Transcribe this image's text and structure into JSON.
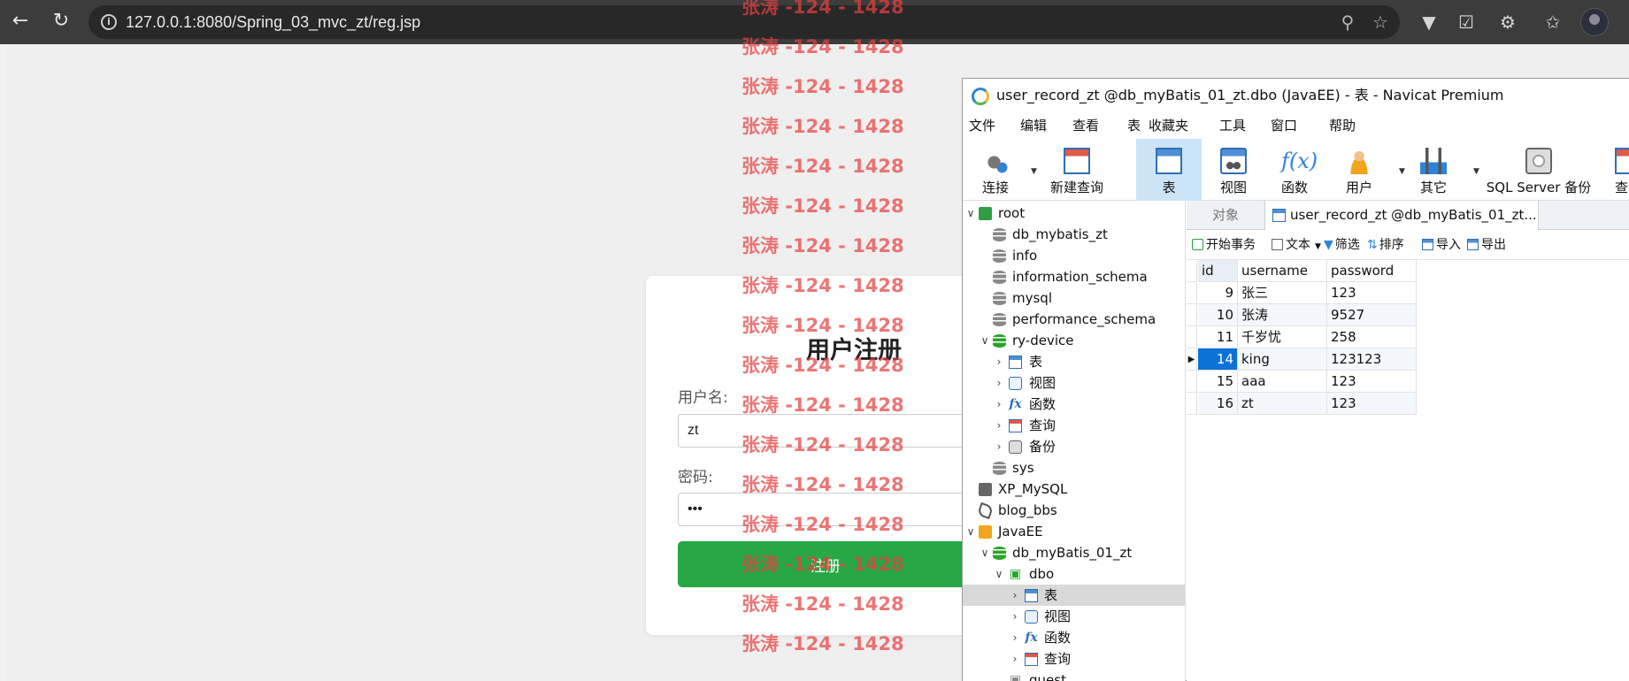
{
  "browser": {
    "url": "127.0.0.1:8080/Spring_03_mvc_zt/reg.jsp",
    "back_icon": "arrow-left",
    "reload_icon": "reload",
    "info_icon": "info-circle",
    "zoom_icon": "magnifier",
    "star_icon": "star"
  },
  "form": {
    "title": "用户注册",
    "username_label": "用户名:",
    "username_value": "zt",
    "password_label": "密码:",
    "password_value": "•••",
    "submit_label": "注册",
    "accent_color": "#28a745"
  },
  "watermark": {
    "text": "张涛 -124 - 1428",
    "lines": [
      "张涛 -124 - 1428",
      "张涛 -124 - 1428",
      "张涛 -124 - 1428",
      "张涛 -124 - 1428",
      "张涛 -124 - 1428",
      "张涛 -124 - 1428",
      "张涛 -124 - 1428",
      "张涛 -124 - 1428",
      "张涛 -124 - 1428",
      "张涛 -124 - 1428",
      "张涛 -124 - 1428",
      "张涛 -124 - 1428",
      "张涛 -124 - 1428",
      "张涛 -124 - 1428",
      "张涛 -124 - 1428",
      "张涛 -124 - 1428",
      "张涛 -124 - 1428"
    ]
  },
  "navicat": {
    "title": "user_record_zt @db_myBatis_01_zt.dbo (JavaEE) - 表 - Navicat Premium",
    "menu": [
      "文件",
      "编辑",
      "查看",
      "表",
      "收藏夹",
      "工具",
      "窗口",
      "帮助"
    ],
    "toolbar": {
      "connect": "连接",
      "new_query": "新建查询",
      "table": "表",
      "view": "视图",
      "function": "函数",
      "user": "用户",
      "other": "其它",
      "sqlserver_backup": "SQL Server 备份",
      "query": "查询"
    },
    "tree": {
      "root": "root",
      "db_mybatis_zt": "db_mybatis_zt",
      "info": "info",
      "information_schema": "information_schema",
      "mysql": "mysql",
      "performance_schema": "performance_schema",
      "ry_device": "ry-device",
      "ry_table": "表",
      "ry_view": "视图",
      "ry_func": "函数",
      "ry_query": "查询",
      "ry_backup": "备份",
      "sys": "sys",
      "xp_mysql": "XP_MySQL",
      "blog_bbs": "blog_bbs",
      "javaee": "JavaEE",
      "db_mybatis_01_zt": "db_myBatis_01_zt",
      "dbo": "dbo",
      "dbo_table": "表",
      "dbo_view": "视图",
      "dbo_func": "函数",
      "dbo_query": "查询",
      "guest": "guest"
    },
    "tabs": {
      "objects": "对象",
      "table_tab": "user_record_zt @db_myBatis_01_zt...."
    },
    "subbar": {
      "begin_transaction": "开始事务",
      "text": "文本",
      "filter": "筛选",
      "sort": "排序",
      "import": "导入",
      "export": "导出"
    },
    "grid": {
      "columns": [
        "id",
        "username",
        "password"
      ],
      "rows": [
        {
          "id": "9",
          "username": "张三",
          "password": "123"
        },
        {
          "id": "10",
          "username": "张涛",
          "password": "9527"
        },
        {
          "id": "11",
          "username": "千岁忧",
          "password": "258"
        },
        {
          "id": "14",
          "username": "king",
          "password": "123123"
        },
        {
          "id": "15",
          "username": "aaa",
          "password": "123"
        },
        {
          "id": "16",
          "username": "zt",
          "password": "123"
        }
      ],
      "selected_color": "#0a72d8"
    }
  }
}
